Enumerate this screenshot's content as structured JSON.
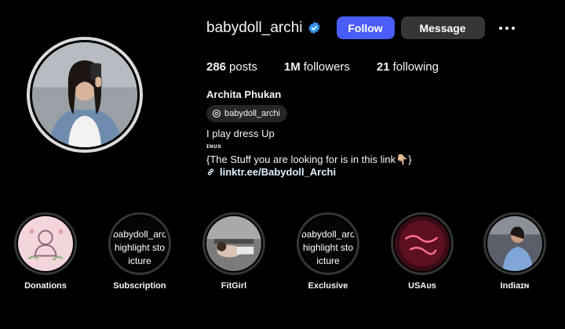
{
  "profile": {
    "username": "babydoll_archi",
    "verified_icon": "verified-badge-icon",
    "follow_label": "Follow",
    "message_label": "Message",
    "more_icon": "more-options-icon"
  },
  "stats": {
    "posts_count": "286",
    "posts_label": "posts",
    "followers_count": "1M",
    "followers_label": "followers",
    "following_count": "21",
    "following_label": "following"
  },
  "bio": {
    "full_name": "Archita Phukan",
    "threads_handle": "babydoll_archi",
    "line1": "I play dress Up",
    "line2": "ɪɴᴜs",
    "line3": "{The Stuff you are looking for is in this link👇🏼}",
    "link_text": "linktr.ee/Babydoll_Archi"
  },
  "highlights": [
    {
      "label": "Donations",
      "overlay": ""
    },
    {
      "label": "Subscription",
      "overlay": "babydoll_arc|highlight sto|icture"
    },
    {
      "label": "FitGirl",
      "overlay": ""
    },
    {
      "label": "Exclusive",
      "overlay": "babydoll_arc|highlight sto|icture"
    },
    {
      "label": "USAᴜs",
      "overlay": ""
    },
    {
      "label": "Indiaɪɴ",
      "overlay": ""
    }
  ],
  "colors": {
    "background": "#000000",
    "follow_button": "#4a5df9",
    "message_button": "#363636",
    "verified": "#3897f0",
    "link": "#e0f1ff"
  }
}
